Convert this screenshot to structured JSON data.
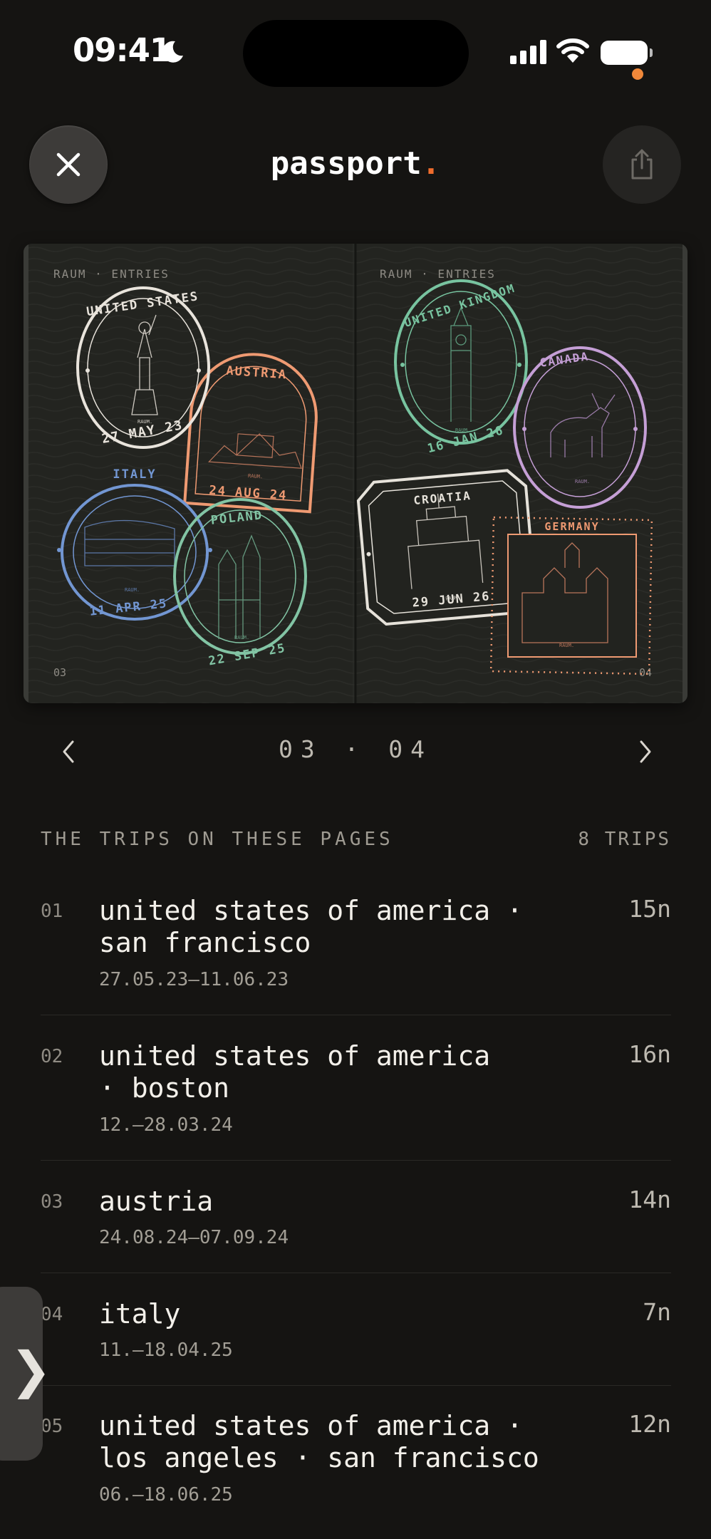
{
  "status_bar": {
    "time": "09:41"
  },
  "header": {
    "title": "passport",
    "title_dot": "."
  },
  "passport": {
    "left_page": {
      "label": "RAUM · ENTRIES",
      "page_number": "03"
    },
    "right_page": {
      "label": "RAUM · ENTRIES",
      "page_number": "04"
    },
    "stamps": [
      {
        "country": "UNITED STATES",
        "date": "27 MAY 23",
        "color": "#e9e4dc",
        "mark": "RAUM."
      },
      {
        "country": "AUSTRIA",
        "date": "24 AUG 24",
        "color": "#ef9a72",
        "mark": "RAUM."
      },
      {
        "country": "ITALY",
        "date": "11 APR 25",
        "color": "#7296d2",
        "mark": "RAUM."
      },
      {
        "country": "POLAND",
        "date": "22 SEP 25",
        "color": "#82c4a4",
        "mark": "RAUM."
      },
      {
        "country": "UNITED KINGDOM",
        "date": "16 JAN 26",
        "color": "#78c4a0",
        "mark": "RAUM."
      },
      {
        "country": "CANADA",
        "date": "",
        "color": "#c59fd6",
        "mark": "RAUM."
      },
      {
        "country": "CROATIA",
        "date": "29 JUN 26",
        "color": "#e6e2da",
        "mark": "RAUM."
      },
      {
        "country": "GERMANY",
        "date": "",
        "color": "#ef9a72",
        "mark": "RAUM."
      }
    ]
  },
  "pager": {
    "label": "03 · 04"
  },
  "trips_section": {
    "heading": "THE TRIPS ON THESE PAGES",
    "count": "8 TRIPS",
    "trips": [
      {
        "num": "01",
        "name_line1": "united states of america ·",
        "name_line2": "san francisco",
        "dates": "27.05.23–11.06.23",
        "nights": "15n"
      },
      {
        "num": "02",
        "name_line1": "united states of america",
        "name_line2": "· boston",
        "dates": "12.–28.03.24",
        "nights": "16n"
      },
      {
        "num": "03",
        "name_line1": "austria",
        "name_line2": "",
        "dates": "24.08.24–07.09.24",
        "nights": "14n"
      },
      {
        "num": "04",
        "name_line1": "italy",
        "name_line2": "",
        "dates": "11.–18.04.25",
        "nights": "7n"
      },
      {
        "num": "05",
        "name_line1": "united states of america ·",
        "name_line2": "los angeles · san francisco",
        "dates": "06.–18.06.25",
        "nights": "12n"
      }
    ]
  },
  "side_tab": {
    "glyph": "❯"
  },
  "colors": {
    "accent": "#ef6c2c",
    "background": "#151412"
  }
}
